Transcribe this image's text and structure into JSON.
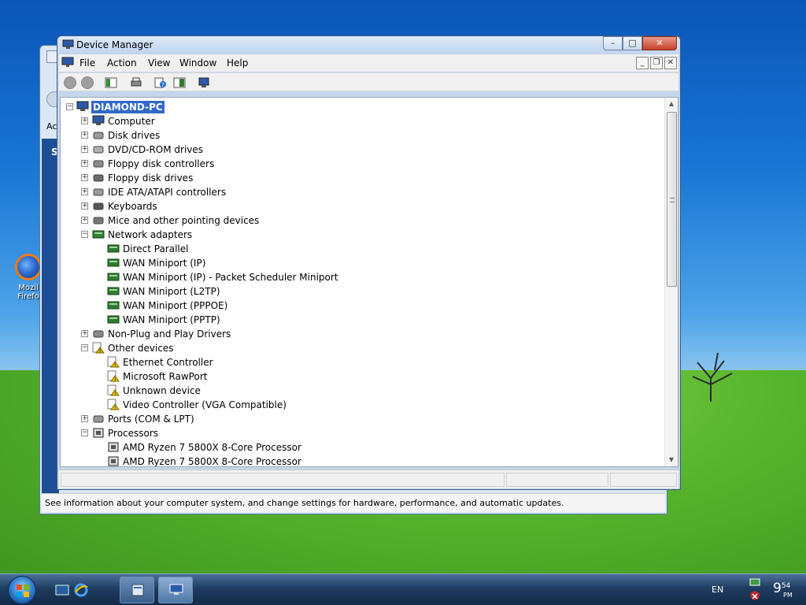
{
  "window": {
    "title": "Device Manager",
    "caption_buttons": {
      "minimize": "–",
      "maximize": "□",
      "close": "✕"
    }
  },
  "menu": {
    "items": [
      "File",
      "Action",
      "View",
      "Window",
      "Help"
    ],
    "mdi_buttons": {
      "minimize": "_",
      "restore": "❐",
      "close": "✕"
    }
  },
  "toolbar": {
    "icons": [
      "back-icon",
      "forward-icon",
      "show-hide-console-tree-icon",
      "print-icon",
      "help-icon",
      "properties-icon",
      "scan-hardware-icon"
    ]
  },
  "tree": {
    "root": "DIAMOND-PC",
    "rows": [
      {
        "label": "Computer",
        "indent": 1,
        "expander": "+",
        "icon": "monitor-icon"
      },
      {
        "label": "Disk drives",
        "indent": 1,
        "expander": "+",
        "icon": "disk-icon"
      },
      {
        "label": "DVD/CD-ROM drives",
        "indent": 1,
        "expander": "+",
        "icon": "dvd-icon"
      },
      {
        "label": "Floppy disk controllers",
        "indent": 1,
        "expander": "+",
        "icon": "controller-icon"
      },
      {
        "label": "Floppy disk drives",
        "indent": 1,
        "expander": "+",
        "icon": "floppy-icon"
      },
      {
        "label": "IDE ATA/ATAPI controllers",
        "indent": 1,
        "expander": "+",
        "icon": "ide-icon"
      },
      {
        "label": "Keyboards",
        "indent": 1,
        "expander": "+",
        "icon": "keyboard-icon"
      },
      {
        "label": "Mice and other pointing devices",
        "indent": 1,
        "expander": "+",
        "icon": "mouse-icon"
      },
      {
        "label": "Network adapters",
        "indent": 1,
        "expander": "−",
        "icon": "network-icon"
      },
      {
        "label": "Direct Parallel",
        "indent": 2,
        "expander": "",
        "icon": "network-icon"
      },
      {
        "label": "WAN Miniport (IP)",
        "indent": 2,
        "expander": "",
        "icon": "network-icon"
      },
      {
        "label": "WAN Miniport (IP) - Packet Scheduler Miniport",
        "indent": 2,
        "expander": "",
        "icon": "network-icon"
      },
      {
        "label": "WAN Miniport (L2TP)",
        "indent": 2,
        "expander": "",
        "icon": "network-icon"
      },
      {
        "label": "WAN Miniport (PPPOE)",
        "indent": 2,
        "expander": "",
        "icon": "network-icon"
      },
      {
        "label": "WAN Miniport (PPTP)",
        "indent": 2,
        "expander": "",
        "icon": "network-icon"
      },
      {
        "label": "Non-Plug and Play Drivers",
        "indent": 1,
        "expander": "+",
        "icon": "driver-icon"
      },
      {
        "label": "Other devices",
        "indent": 1,
        "expander": "−",
        "icon": "unknown-device-icon"
      },
      {
        "label": "Ethernet Controller",
        "indent": 2,
        "expander": "",
        "icon": "warning-device-icon"
      },
      {
        "label": "Microsoft RawPort",
        "indent": 2,
        "expander": "",
        "icon": "warning-device-icon"
      },
      {
        "label": "Unknown device",
        "indent": 2,
        "expander": "",
        "icon": "warning-device-icon"
      },
      {
        "label": "Video Controller (VGA Compatible)",
        "indent": 2,
        "expander": "",
        "icon": "warning-device-icon"
      },
      {
        "label": "Ports (COM & LPT)",
        "indent": 1,
        "expander": "+",
        "icon": "port-icon"
      },
      {
        "label": "Processors",
        "indent": 1,
        "expander": "−",
        "icon": "cpu-icon"
      },
      {
        "label": "AMD Ryzen 7 5800X 8-Core Processor",
        "indent": 2,
        "expander": "",
        "icon": "cpu-icon"
      },
      {
        "label": "AMD Ryzen 7 5800X 8-Core Processor",
        "indent": 2,
        "expander": "",
        "icon": "cpu-icon"
      }
    ]
  },
  "background_window": {
    "status_text": "See information about your computer system, and change settings for hardware, performance, and automatic updates.",
    "partial_label": "Ac",
    "partial_side_letter": "S"
  },
  "desktop": {
    "icon_label_line1": "Mozil",
    "icon_label_line2": "Firefo"
  },
  "taskbar": {
    "language": "EN",
    "time_hour": "9",
    "time_minutes": "54",
    "time_ampm": "PM"
  },
  "colors": {
    "selection": "#3169c6",
    "title_gradient_top": "#dce8f7",
    "close_button": "#c7402b"
  }
}
